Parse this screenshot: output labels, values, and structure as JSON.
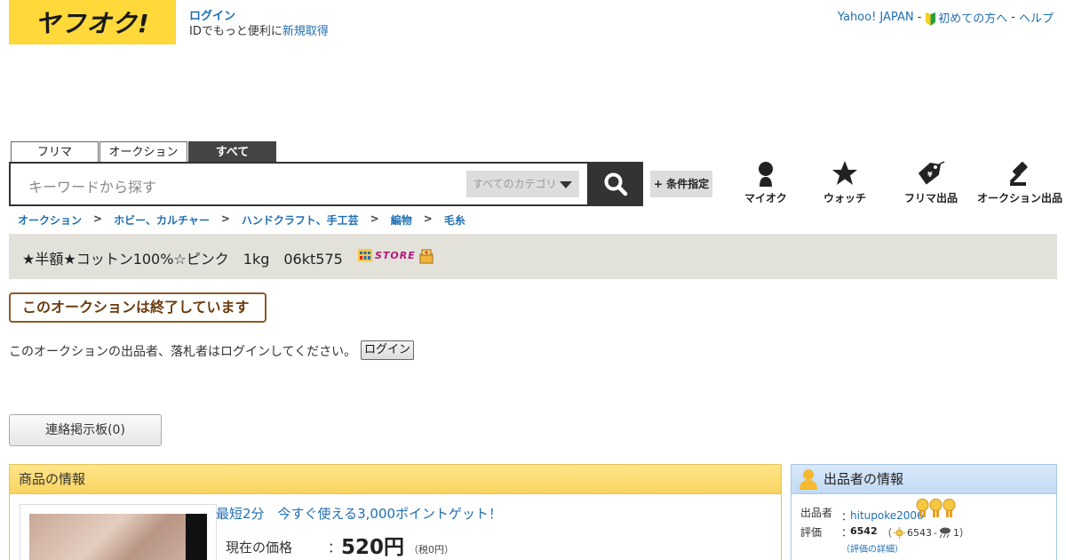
{
  "header": {
    "logo_text": "ヤフオク!",
    "login_label": "ログイン",
    "id_promo_text": "IDでもっと便利に",
    "register_link": "新規取得",
    "top_links": {
      "yahoo_japan": "Yahoo! JAPAN",
      "sep1": "-",
      "beginners": "初めての方へ",
      "sep2": "-",
      "help": "ヘルプ"
    }
  },
  "search": {
    "tabs": [
      {
        "label": "フリマ",
        "active": false
      },
      {
        "label": "オークション",
        "active": false
      },
      {
        "label": "すべて",
        "active": true
      }
    ],
    "placeholder": "キーワードから探す",
    "category_selected": "すべてのカテゴリ",
    "conditions_label": "+ 条件指定"
  },
  "nav_icons": [
    {
      "label": "マイオク",
      "icon": "user-icon"
    },
    {
      "label": "ウォッチ",
      "icon": "star-icon"
    },
    {
      "label": "フリマ出品",
      "icon": "price-tag-icon"
    },
    {
      "label": "オークション出品",
      "icon": "gavel-icon"
    }
  ],
  "breadcrumb": {
    "items": [
      "オークション",
      "ホビー、カルチャー",
      "ハンドクラフト、手工芸",
      "編物",
      "毛糸"
    ],
    "separator": ">"
  },
  "item": {
    "title": "★半額★コットン100%☆ピンク　1kg　06kt575",
    "store_badge": "STORE",
    "ended_message": "このオークションは終了しています",
    "login_notice": "このオークションの出品者、落札者はログインしてください。",
    "login_button": "ログイン",
    "board_button": "連絡掲示板(0)"
  },
  "product_info": {
    "heading": "商品の情報",
    "promo": "最短2分　今すぐ使える3,000ポイントゲット！",
    "price_label": "現在の価格",
    "price_colon": "：",
    "price_value": "520円",
    "price_tax": "（税0円）"
  },
  "seller_info": {
    "heading": "出品者の情報",
    "seller_label": "出品者",
    "seller_colon": "：",
    "seller_name": "hitupoke2006",
    "rating_label": "評価",
    "rating_colon": "：",
    "rating_total": "6542",
    "rating_open": "（",
    "rating_good": "6543",
    "rating_dash": "-",
    "rating_bad": "1）",
    "rating_detail_link": "（評価の詳細）"
  },
  "colors": {
    "brand_yellow": "#ffd83a",
    "link_blue": "#1f6fb2",
    "title_bar_bg": "#e2e1da",
    "ended_border": "#8c5a2b"
  }
}
